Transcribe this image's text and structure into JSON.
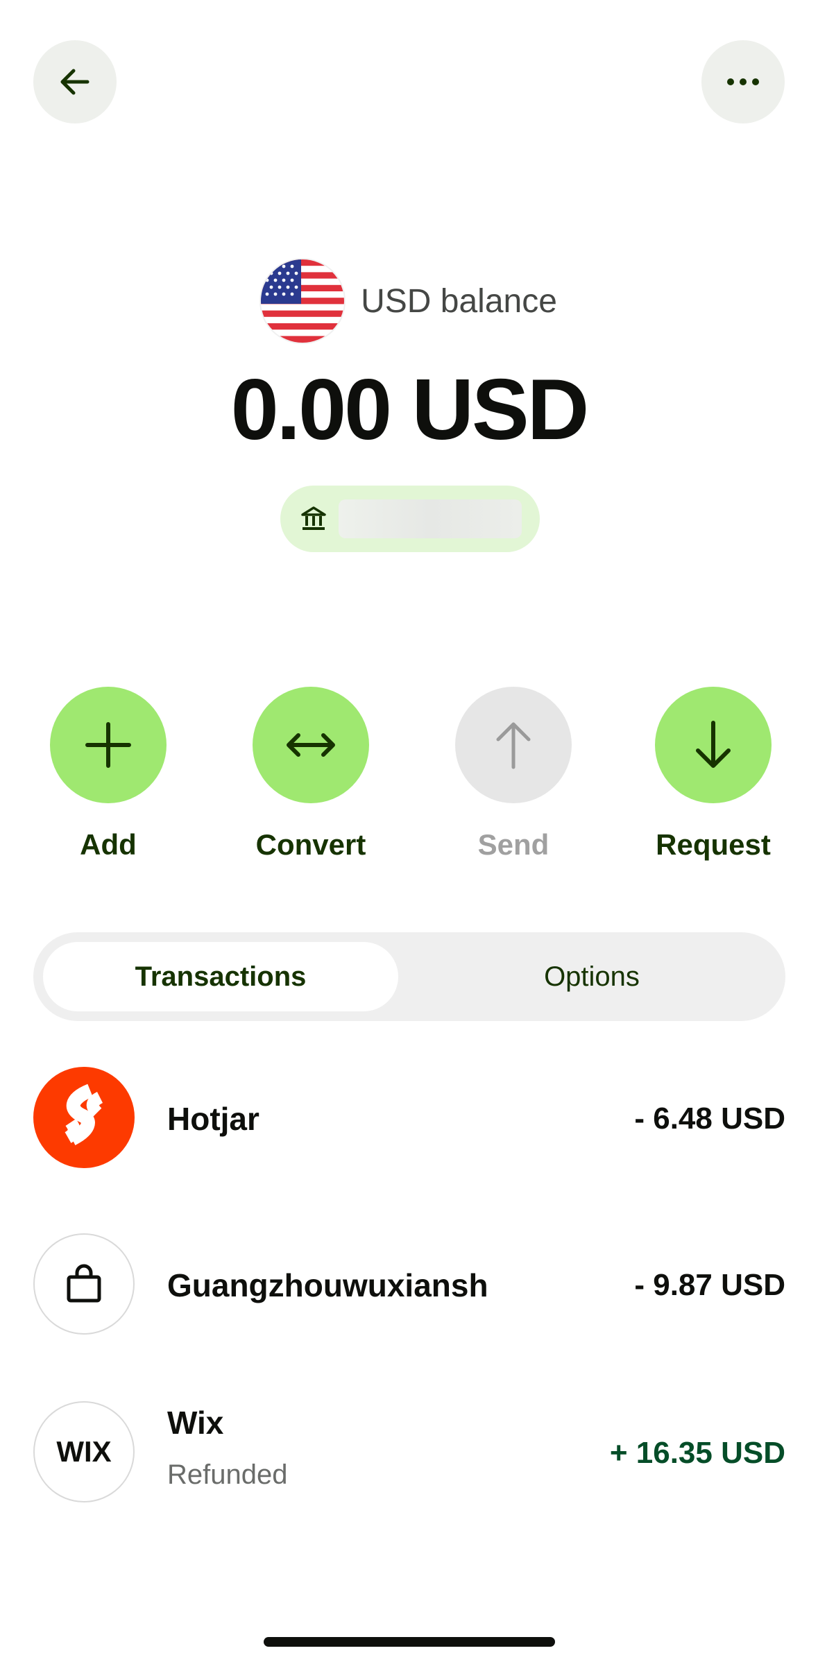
{
  "header": {
    "back_icon": "arrow-left-icon",
    "more_icon": "more-horizontal-icon"
  },
  "balance": {
    "flag_icon": "us-flag-icon",
    "label": "USD balance",
    "amount": "0.00 USD",
    "bank_icon": "bank-icon"
  },
  "actions": [
    {
      "label": "Add",
      "icon": "plus-icon",
      "enabled": true
    },
    {
      "label": "Convert",
      "icon": "arrows-horizontal-icon",
      "enabled": true
    },
    {
      "label": "Send",
      "icon": "arrow-up-icon",
      "enabled": false
    },
    {
      "label": "Request",
      "icon": "arrow-down-icon",
      "enabled": true
    }
  ],
  "tabs": {
    "active": "Transactions",
    "inactive": "Options"
  },
  "transactions": [
    {
      "name": "Hotjar",
      "subtitle": "",
      "amount": "- 6.48 USD",
      "avatar": "hotjar-logo-icon",
      "color": "#fd3a00"
    },
    {
      "name": "Guangzhouwuxiansh",
      "subtitle": "",
      "amount": "- 9.87 USD",
      "avatar": "shopping-bag-icon"
    },
    {
      "name": "Wix",
      "subtitle": "Refunded",
      "amount": "+ 16.35 USD",
      "avatar_text": "WIX",
      "amount_color": "#054d28"
    }
  ],
  "colors": {
    "accent": "#9fe870",
    "accent_text": "#163300",
    "positive": "#054d28"
  }
}
